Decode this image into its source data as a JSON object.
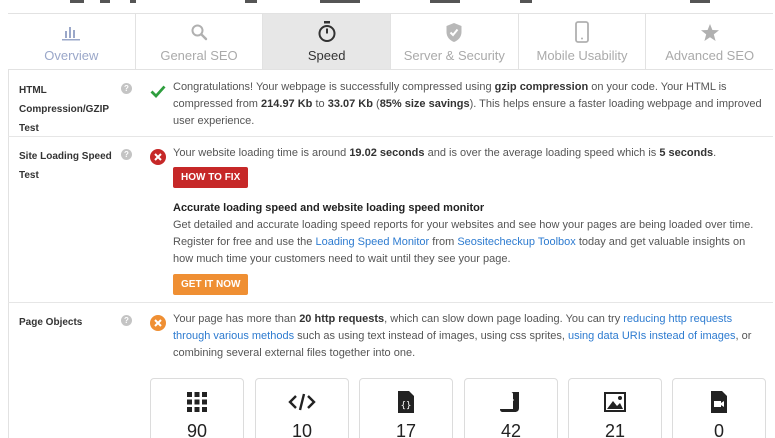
{
  "tabs": [
    {
      "label": "Overview",
      "icon": "bar-chart-icon",
      "active": false
    },
    {
      "label": "General SEO",
      "icon": "search-icon",
      "active": false
    },
    {
      "label": "Speed",
      "icon": "stopwatch-icon",
      "active": true
    },
    {
      "label": "Server & Security",
      "icon": "shield-check-icon",
      "active": false
    },
    {
      "label": "Mobile Usability",
      "icon": "smartphone-icon",
      "active": false
    },
    {
      "label": "Advanced SEO",
      "icon": "star-icon",
      "active": false
    }
  ],
  "compression": {
    "name": "HTML Compression/GZIP Test",
    "status": "pass",
    "text_1": "Congratulations! Your webpage is successfully compressed using ",
    "bold_1": "gzip compression",
    "text_2": " on your code. Your HTML is compressed from ",
    "bold_2": "214.97 Kb",
    "text_3": " to ",
    "bold_3": "33.07 Kb",
    "text_4": " (",
    "bold_4": "85% size savings",
    "text_5": "). This helps ensure a faster loading webpage and improved user experience."
  },
  "loading_speed": {
    "name": "Site Loading Speed Test",
    "status": "fail",
    "text_1": "Your website loading time is around ",
    "bold_1": "19.02 seconds",
    "text_2": " and is over the average loading speed which is ",
    "bold_2": "5 seconds",
    "text_3": ".",
    "fix_button": "HOW TO FIX",
    "promo_title": "Accurate loading speed and website loading speed monitor",
    "promo_1": "Get detailed and accurate loading speed reports for your websites and see how your pages are being loaded over time. Register for free and use the ",
    "promo_link_1": "Loading Speed Monitor",
    "promo_2": " from ",
    "promo_link_2": "Seositecheckup Toolbox",
    "promo_3": " today and get valuable insights on how much time your customers need to wait until they see your page.",
    "cta_button": "GET IT NOW"
  },
  "page_objects": {
    "name": "Page Objects",
    "status": "warning",
    "text_1": "Your page has more than ",
    "bold_1": "20 http requests",
    "text_2": ", which can slow down page loading. You can try ",
    "link_1": "reducing http requests through various methods",
    "text_3": " such as using text instead of images, using css sprites, ",
    "link_2": "using data URIs instead of images",
    "text_4": ", or combining several external files together into one.",
    "cards": [
      {
        "icon": "grid-icon",
        "count": "90"
      },
      {
        "icon": "code-icon",
        "count": "10"
      },
      {
        "icon": "css-file-icon",
        "count": "17"
      },
      {
        "icon": "script-icon",
        "count": "42"
      },
      {
        "icon": "image-icon",
        "count": "21"
      },
      {
        "icon": "video-file-icon",
        "count": "0"
      }
    ]
  },
  "colors": {
    "pass": "#2e9e3e",
    "fail": "#c62828",
    "warning": "#ef8f33",
    "link": "#2d7bd0",
    "active_tab": "#e7e7e7"
  }
}
